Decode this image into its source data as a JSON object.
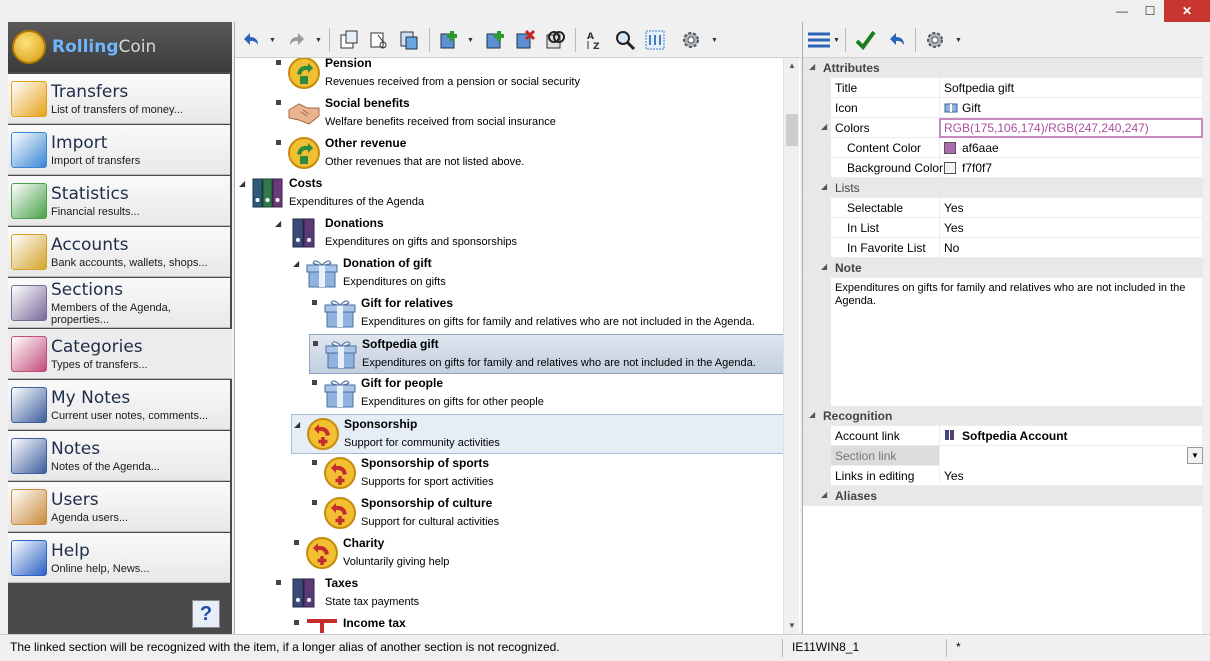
{
  "window": {
    "minimize_glyph": "—",
    "maximize_glyph": "☐",
    "close_glyph": "✕"
  },
  "app": {
    "logo_part1": "Rolling",
    "logo_part2": "Coin"
  },
  "nav": [
    {
      "title": "Transfers",
      "subtitle": "List of transfers of money...",
      "icon": "transfers-icon",
      "color": "#e6a21a"
    },
    {
      "title": "Import",
      "subtitle": "Import of transfers",
      "icon": "import-icon",
      "color": "#3a86d4"
    },
    {
      "title": "Statistics",
      "subtitle": "Financial results...",
      "icon": "statistics-icon",
      "color": "#4aa04a"
    },
    {
      "title": "Accounts",
      "subtitle": "Bank accounts, wallets, shops...",
      "icon": "accounts-icon",
      "color": "#d3a22a"
    },
    {
      "title": "Sections",
      "subtitle": "Members of the Agenda, properties...",
      "icon": "sections-icon",
      "color": "#7a6a9a"
    },
    {
      "title": "Categories",
      "subtitle": "Types of transfers...",
      "icon": "categories-icon",
      "color": "#c24c7a",
      "active": true
    },
    {
      "title": "My Notes",
      "subtitle": "Current user notes, comments...",
      "icon": "my-notes-icon",
      "color": "#3c5e9c"
    },
    {
      "title": "Notes",
      "subtitle": "Notes of the Agenda...",
      "icon": "notes-icon",
      "color": "#3c5e9c"
    },
    {
      "title": "Users",
      "subtitle": "Agenda users...",
      "icon": "users-icon",
      "color": "#c98a3a"
    },
    {
      "title": "Help",
      "subtitle": "Online help, News...",
      "icon": "help-icon",
      "color": "#2b62c4"
    }
  ],
  "help_button": "?",
  "tree": [
    {
      "title": "Pension",
      "desc": "Revenues received from a pension or social security",
      "icon": "revenue-coin-icon",
      "level": 1,
      "type": "leaf"
    },
    {
      "title": "Social benefits",
      "desc": "Welfare benefits received from social insurance",
      "icon": "handshake-icon",
      "level": 1,
      "type": "leaf"
    },
    {
      "title": "Other revenue",
      "desc": "Other revenues that are not listed above.",
      "icon": "revenue-coin-icon",
      "level": 1,
      "type": "leaf"
    },
    {
      "title": "Costs",
      "desc": "Expenditures of the Agenda",
      "icon": "binders-icon",
      "level": 0,
      "type": "open"
    },
    {
      "title": "Donations",
      "desc": "Expenditures on gifts and sponsorships",
      "icon": "binder-icon",
      "level": 1,
      "type": "open"
    },
    {
      "title": "Donation of gift",
      "desc": "Expenditures on gifts",
      "icon": "gift-icon",
      "level": 2,
      "type": "open"
    },
    {
      "title": "Gift for relatives",
      "desc": "Expenditures on gifts for family and relatives who are not included in the Agenda.",
      "icon": "gift-icon",
      "level": 3,
      "type": "leaf"
    },
    {
      "title": "Softpedia gift",
      "desc": "Expenditures on gifts for family and relatives who are not included in the Agenda.",
      "icon": "gift-icon",
      "level": 3,
      "type": "leaf",
      "state": "selected"
    },
    {
      "title": "Gift for people",
      "desc": "Expenditures on gifts for other people",
      "icon": "gift-icon",
      "level": 3,
      "type": "leaf"
    },
    {
      "title": "Sponsorship",
      "desc": "Support for community activities",
      "icon": "expense-coin-icon",
      "level": 2,
      "type": "open",
      "state": "highlight"
    },
    {
      "title": "Sponsorship of sports",
      "desc": "Supports for sport activities",
      "icon": "expense-coin-icon",
      "level": 3,
      "type": "leaf"
    },
    {
      "title": "Sponsorship of culture",
      "desc": "Support for cultural activities",
      "icon": "expense-coin-icon",
      "level": 3,
      "type": "leaf"
    },
    {
      "title": "Charity",
      "desc": "Voluntarily giving help",
      "icon": "expense-coin-icon",
      "level": 2,
      "type": "leaf"
    },
    {
      "title": "Taxes",
      "desc": "State tax payments",
      "icon": "binder-icon",
      "level": 1,
      "type": "leaf"
    },
    {
      "title": "Income tax",
      "desc": "",
      "icon": "tax-icon",
      "level": 2,
      "type": "leaf"
    }
  ],
  "props": {
    "attributes": {
      "label": "Attributes",
      "title_name": "Title",
      "title_value": "Softpedia gift",
      "icon_name": "Icon",
      "icon_value": "Gift",
      "colors_name": "Colors",
      "colors_value": "RGB(175,106,174)/RGB(247,240,247)",
      "content_color_name": "Content Color",
      "content_color_value": "af6aae",
      "content_color_hex": "#af6aae",
      "background_color_name": "Background Color",
      "background_color_value": "f7f0f7",
      "background_color_hex": "#f7f0f7"
    },
    "lists": {
      "label": "Lists",
      "selectable_name": "Selectable",
      "selectable_value": "Yes",
      "inlist_name": "In List",
      "inlist_value": "Yes",
      "infav_name": "In Favorite List",
      "infav_value": "No"
    },
    "note": {
      "label": "Note",
      "text": "Expenditures on gifts for family and relatives who are not included in the Agenda."
    },
    "recognition": {
      "label": "Recognition",
      "account_link_name": "Account link",
      "account_link_value": "Softpedia Account",
      "section_link_name": "Section link",
      "section_link_value": "",
      "links_editing_name": "Links in editing",
      "links_editing_value": "Yes"
    },
    "aliases": {
      "label": "Aliases"
    }
  },
  "status": {
    "message": "The linked section will be recognized with the item, if a longer alias of another section is not recognized.",
    "host": "IE11WIN8_1",
    "modified": "*"
  }
}
